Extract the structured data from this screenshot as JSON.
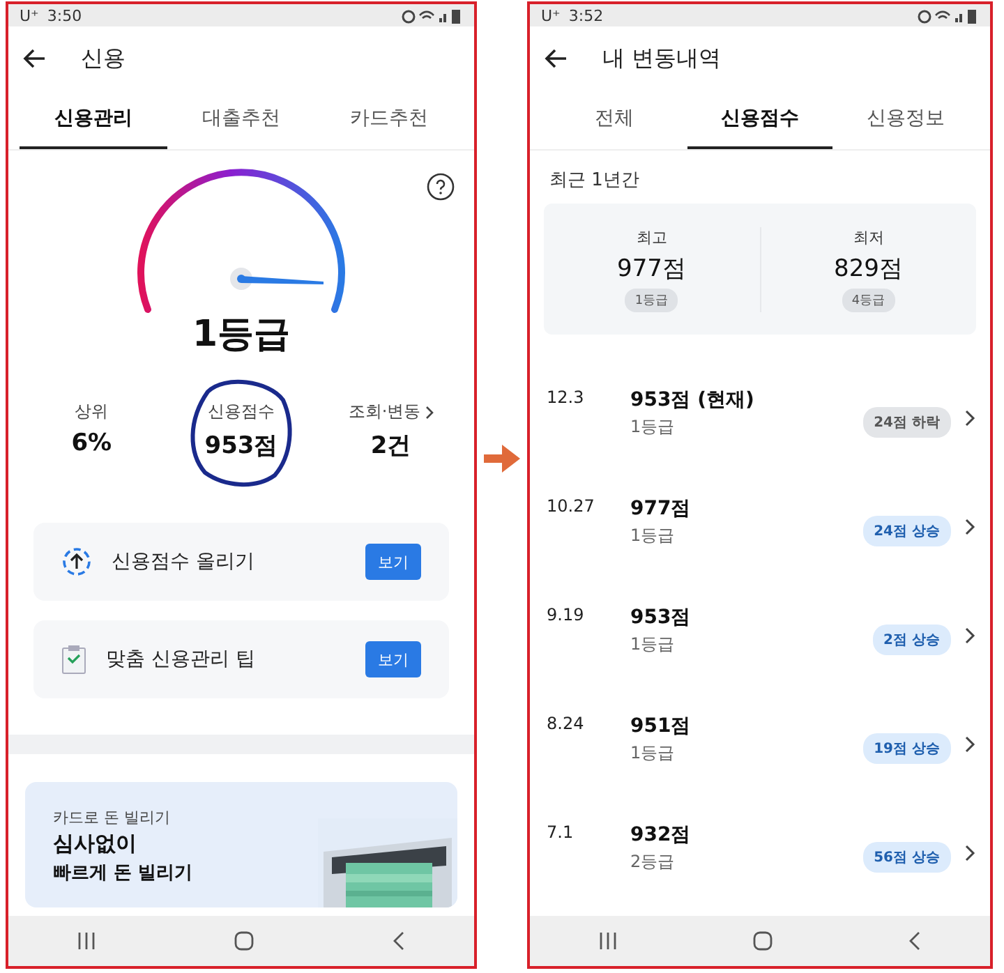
{
  "left": {
    "status_bar": {
      "carrier": "U⁺",
      "time": "3:50"
    },
    "title": "신용",
    "tabs": [
      {
        "label": "신용관리",
        "selected": true
      },
      {
        "label": "대출추천",
        "selected": false
      },
      {
        "label": "카드추천",
        "selected": false
      }
    ],
    "grade": "1등급",
    "stats": [
      {
        "label": "상위",
        "value": "6%",
        "link": false
      },
      {
        "label": "신용점수",
        "value": "953점",
        "link": false,
        "circled": true
      },
      {
        "label": "조회·변동",
        "value": "2건",
        "link": true
      }
    ],
    "actions": [
      {
        "kind": "raise",
        "label": "신용점수 올리기",
        "button": "보기"
      },
      {
        "kind": "tips",
        "label": "맞춤 신용관리 팁",
        "button": "보기"
      }
    ],
    "promo": {
      "eyebrow": "카드로 돈 빌리기",
      "title": "심사없이",
      "subtitle": "빠르게 돈 빌리기",
      "kind": "picture"
    }
  },
  "right": {
    "status_bar": {
      "carrier": "U⁺",
      "time": "3:52"
    },
    "title": "내 변동내역",
    "tabs": [
      {
        "label": "전체",
        "selected": false
      },
      {
        "label": "신용점수",
        "selected": true
      },
      {
        "label": "신용정보",
        "selected": false
      }
    ],
    "period": "최근 1년간",
    "summary": [
      {
        "label": "최고",
        "value": "977점",
        "grade": "1등급"
      },
      {
        "label": "최저",
        "value": "829점",
        "grade": "4등급"
      }
    ],
    "history": [
      {
        "date": "12.3",
        "score": "953점 (현재)",
        "grade": "1등급",
        "change": "24점 하락",
        "kind": "down"
      },
      {
        "date": "10.27",
        "score": "977점",
        "grade": "1등급",
        "change": "24점 상승",
        "kind": "up"
      },
      {
        "date": "9.19",
        "score": "953점",
        "grade": "1등급",
        "change": "2점 상승",
        "kind": "up"
      },
      {
        "date": "8.24",
        "score": "951점",
        "grade": "1등급",
        "change": "19점 상승",
        "kind": "up"
      },
      {
        "date": "7.1",
        "score": "932점",
        "grade": "2등급",
        "change": "56점 상승",
        "kind": "up"
      }
    ]
  }
}
